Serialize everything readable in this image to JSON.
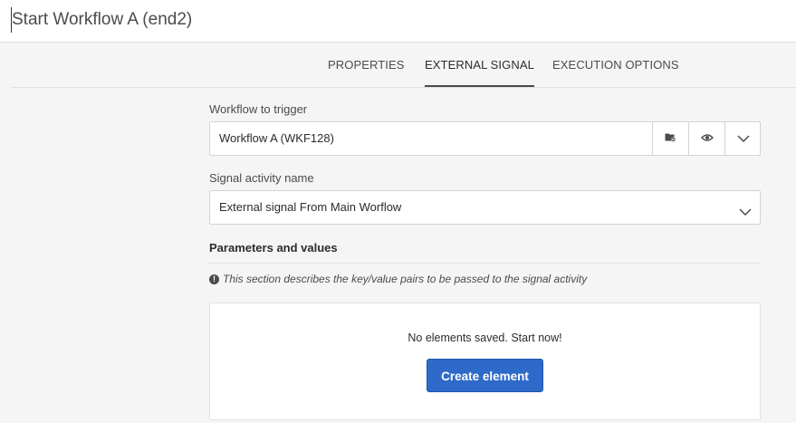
{
  "header": {
    "title": "Start Workflow A (end2)"
  },
  "tabs": [
    {
      "label": "PROPERTIES",
      "active": false
    },
    {
      "label": "EXTERNAL SIGNAL",
      "active": true
    },
    {
      "label": "EXECUTION OPTIONS",
      "active": false
    }
  ],
  "workflow_trigger": {
    "label": "Workflow to trigger",
    "value": "Workflow A (WKF128)",
    "icons": [
      "folder-icon",
      "eye-icon",
      "chevron-down-icon"
    ]
  },
  "signal_activity": {
    "label": "Signal activity name",
    "value": "External signal From Main Worflow",
    "icons": [
      "chevron-down-icon"
    ]
  },
  "parameters": {
    "title": "Parameters and values",
    "info": "This section describes the key/value pairs to be passed to the signal activity",
    "empty_text": "No elements saved. Start now!",
    "create_label": "Create element"
  },
  "colors": {
    "accent": "#2d6ac9",
    "background": "#f5f5f5",
    "border": "#d3d3d3"
  }
}
